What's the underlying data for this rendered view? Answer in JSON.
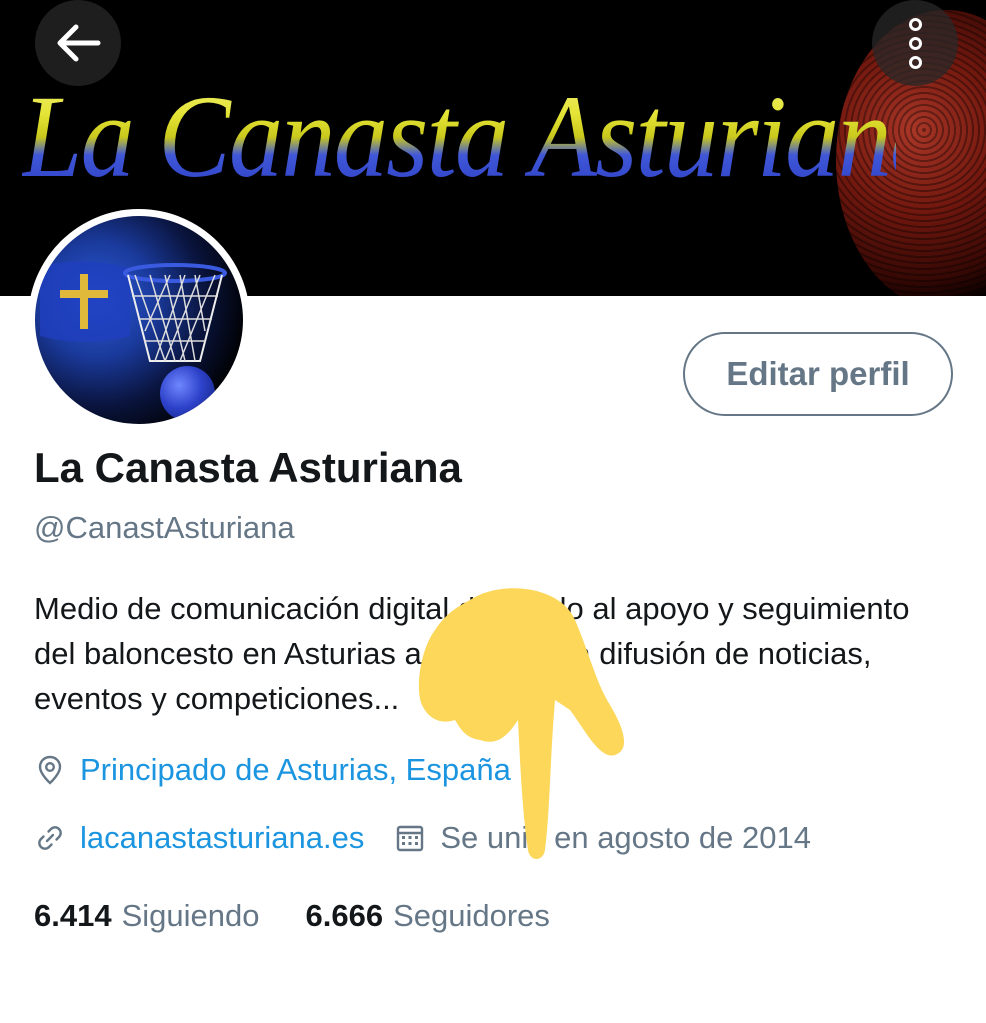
{
  "banner": {
    "title": "La Canasta Asturiana"
  },
  "header": {
    "back_icon": "arrow-left-icon",
    "more_icon": "more-vertical-icon"
  },
  "profile": {
    "edit_button": "Editar perfil",
    "name": "La Canasta Asturiana",
    "handle": "@CanastAsturiana",
    "bio": "Medio de comunicación digital dedicado al apoyo y seguimiento del baloncesto en Asturias a través de la difusión de noticias, eventos y competiciones...",
    "location": "Principado de Asturias, España",
    "website": "lacanastasturiana.es",
    "joined": "Se unió en agosto de 2014",
    "following_count": "6.414",
    "following_label": "Siguiendo",
    "followers_count": "6.666",
    "followers_label": "Seguidores"
  },
  "colors": {
    "link": "#1b95e0",
    "secondary": "#657786",
    "primary_text": "#14171a",
    "overlay": "#fcd75a"
  }
}
